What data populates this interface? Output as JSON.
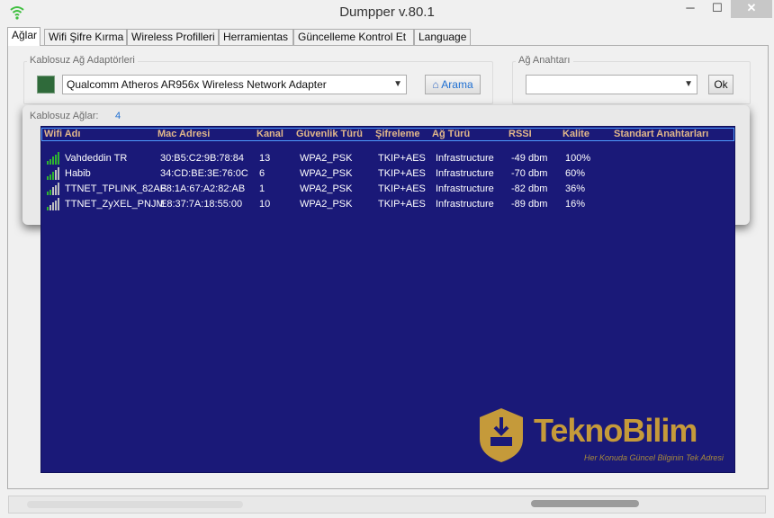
{
  "window": {
    "title": "Dumpper v.80.1"
  },
  "tabs": [
    {
      "label": "Ağlar"
    },
    {
      "label": "Wifi Şifre Kırma"
    },
    {
      "label": "Wireless Profilleri"
    },
    {
      "label": "Herramientas"
    },
    {
      "label": "Güncelleme Kontrol Et"
    },
    {
      "label": "Language"
    }
  ],
  "adapters": {
    "group_label": "Kablosuz Ağ Adaptörleri",
    "selected": "Qualcomm Atheros AR956x Wireless Network Adapter",
    "search_label": "Arama"
  },
  "key": {
    "group_label": "Ağ Anahtarı",
    "value": "",
    "ok_label": "Ok"
  },
  "networks": {
    "label": "Kablosuz Ağlar:",
    "count": "4",
    "columns": [
      "Wifi Adı",
      "Mac Adresi",
      "Kanal",
      "Güvenlik Türü",
      "Şifreleme",
      "Ağ Türü",
      "RSSI",
      "Kalite",
      "Standart Anahtarları"
    ],
    "rows": [
      {
        "ssid": "Vahdeddin TR",
        "mac": "30:B5:C2:9B:78:84",
        "channel": "13",
        "security": "WPA2_PSK",
        "encryption": "TKIP+AES",
        "type": "Infrastructure",
        "rssi": "-49 dbm",
        "quality": "100%",
        "quality_value": 100
      },
      {
        "ssid": "Habib",
        "mac": "34:CD:BE:3E:76:0C",
        "channel": "6",
        "security": "WPA2_PSK",
        "encryption": "TKIP+AES",
        "type": "Infrastructure",
        "rssi": "-70 dbm",
        "quality": "60%",
        "quality_value": 60
      },
      {
        "ssid": "TTNET_TPLINK_82AB",
        "mac": "F8:1A:67:A2:82:AB",
        "channel": "1",
        "security": "WPA2_PSK",
        "encryption": "TKIP+AES",
        "type": "Infrastructure",
        "rssi": "-82 dbm",
        "quality": "36%",
        "quality_value": 36
      },
      {
        "ssid": "TTNET_ZyXEL_PNJM",
        "mac": "E8:37:7A:18:55:00",
        "channel": "10",
        "security": "WPA2_PSK",
        "encryption": "TKIP+AES",
        "type": "Infrastructure",
        "rssi": "-89 dbm",
        "quality": "16%",
        "quality_value": 16
      }
    ]
  },
  "watermark": {
    "brand": "TeknoBilim",
    "tagline": "Her Konuda Güncel Bilginin Tek Adresi"
  },
  "colors": {
    "list_background": "#1a1978",
    "header_text": "#e1b78a",
    "signal_green": "#2fb52f",
    "accent_blue": "#1e6fd2"
  }
}
